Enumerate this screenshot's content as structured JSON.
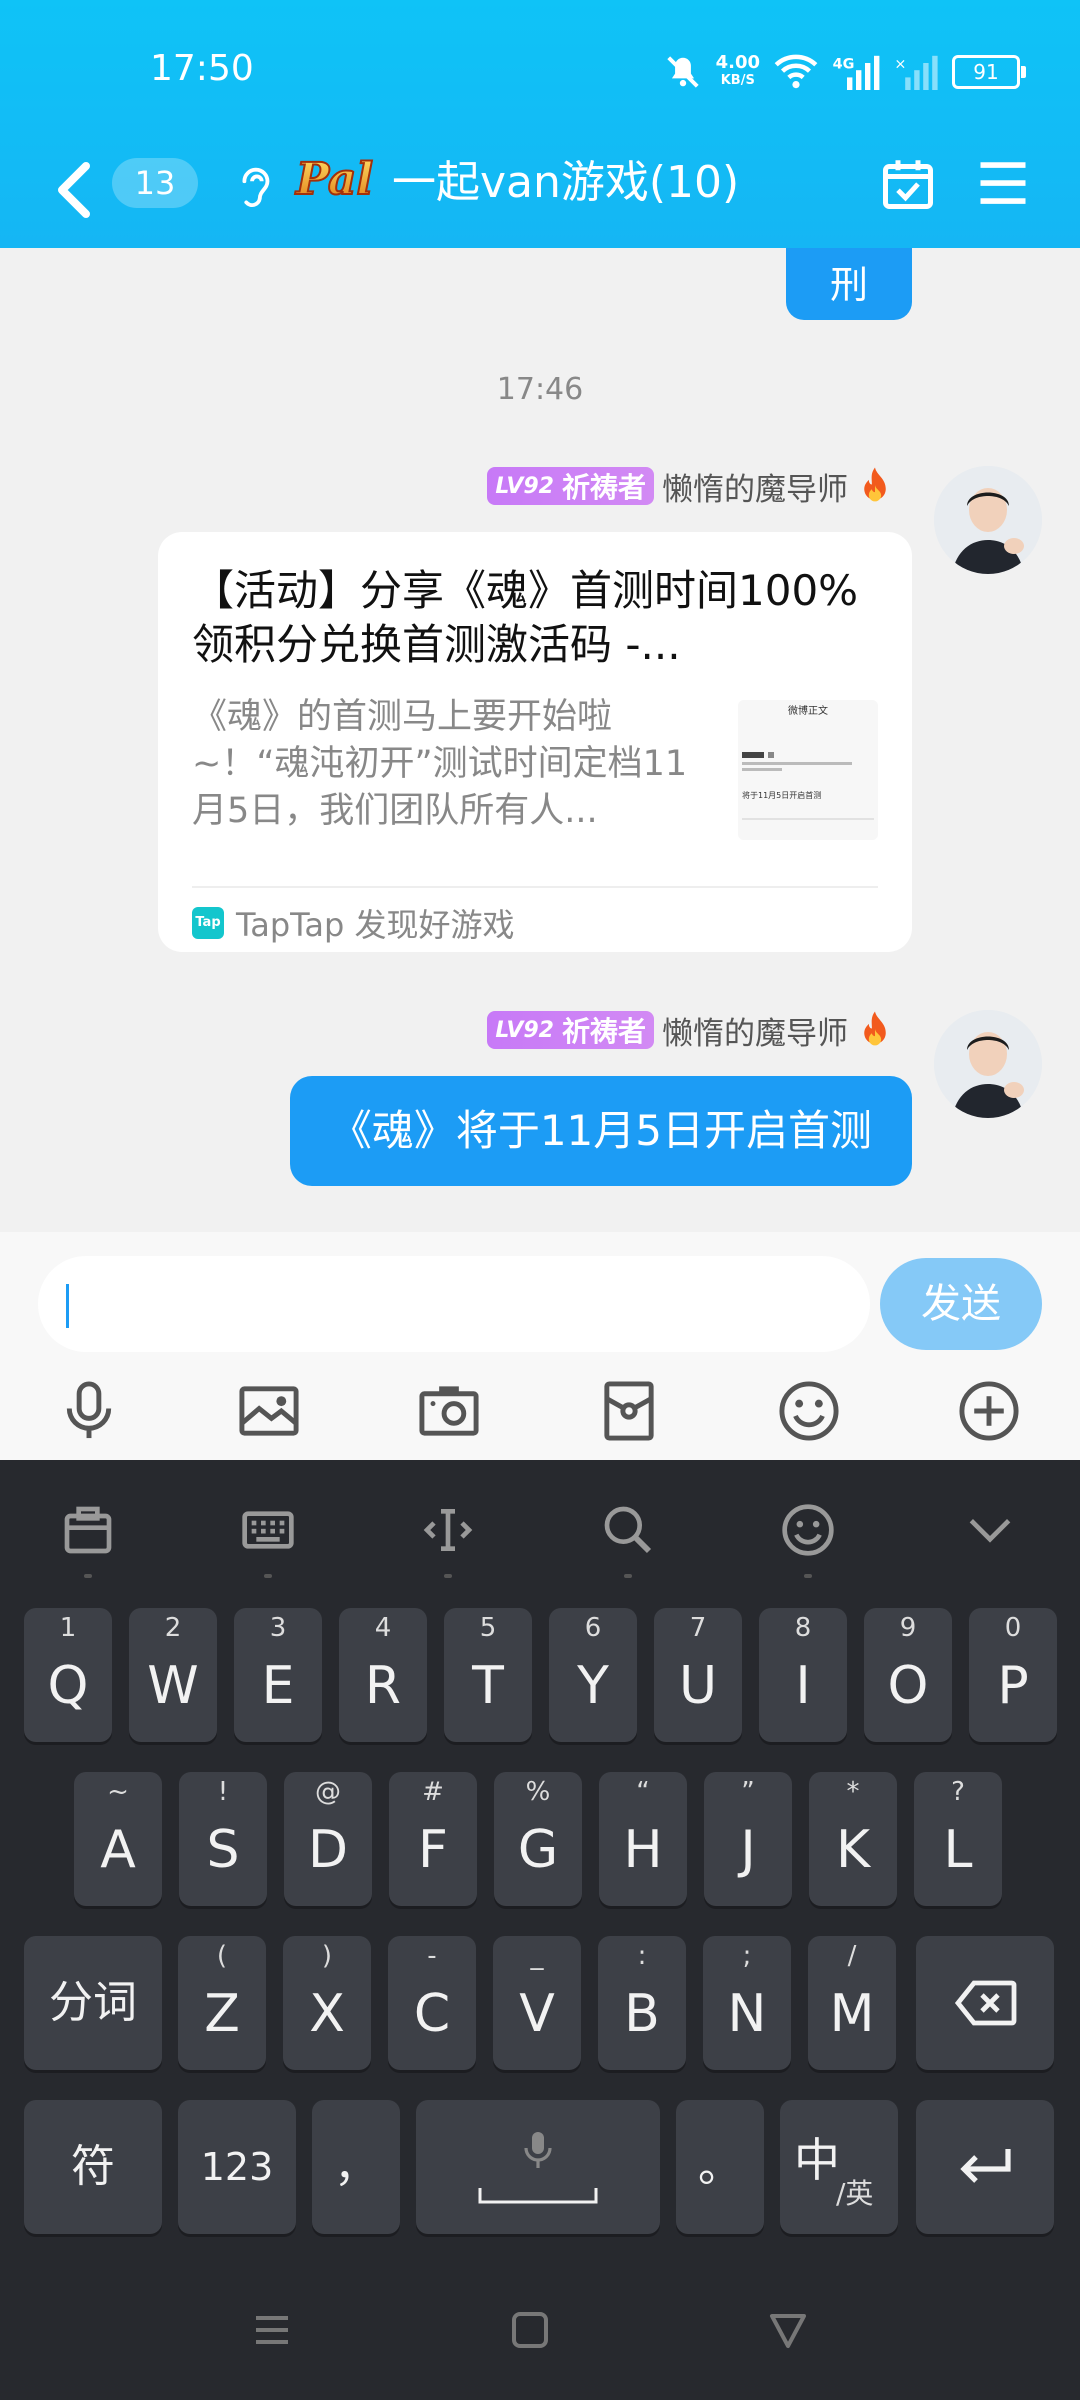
{
  "status": {
    "time": "17:50",
    "net_speed_value": "4.00",
    "net_speed_unit": "KB/S",
    "network": "4G",
    "battery": "91"
  },
  "nav": {
    "unread_count": "13",
    "group_title": "一起van游戏(10)",
    "logo_text": "Pal"
  },
  "chat": {
    "prev_message_fragment": "刑",
    "timestamp": "17:46",
    "messages": [
      {
        "sender_level": "LV92",
        "sender_title": "祈祷者",
        "sender_name": "懒惰的魔导师",
        "card_title": "【活动】分享《魂》首测时间100%领积分兑换首测激活码 -...",
        "card_description": "《魂》的首测马上要开始啦~！“魂沌初开”测试时间定档11月5日，我们团队所有人...",
        "card_source_icon": "Tap",
        "card_source": "TapTap 发现好游戏",
        "thumb_heading": "微博正文",
        "thumb_line": "将于11月5日开启首测"
      },
      {
        "sender_level": "LV92",
        "sender_title": "祈祷者",
        "sender_name": "懒惰的魔导师",
        "text": "《魂》将于11月5日开启首测"
      }
    ]
  },
  "input": {
    "value": "",
    "send_label": "发送"
  },
  "toolbar": [
    "microphone-icon",
    "image-icon",
    "camera-icon",
    "red-packet-icon",
    "emoji-icon",
    "plus-icon"
  ],
  "keyboard": {
    "row1": [
      {
        "k": "Q",
        "s": "1"
      },
      {
        "k": "W",
        "s": "2"
      },
      {
        "k": "E",
        "s": "3"
      },
      {
        "k": "R",
        "s": "4"
      },
      {
        "k": "T",
        "s": "5"
      },
      {
        "k": "Y",
        "s": "6"
      },
      {
        "k": "U",
        "s": "7"
      },
      {
        "k": "I",
        "s": "8"
      },
      {
        "k": "O",
        "s": "9"
      },
      {
        "k": "P",
        "s": "0"
      }
    ],
    "row2": [
      {
        "k": "A",
        "s": "~"
      },
      {
        "k": "S",
        "s": "!"
      },
      {
        "k": "D",
        "s": "@"
      },
      {
        "k": "F",
        "s": "#"
      },
      {
        "k": "G",
        "s": "%"
      },
      {
        "k": "H",
        "s": "“"
      },
      {
        "k": "J",
        "s": "”"
      },
      {
        "k": "K",
        "s": "*"
      },
      {
        "k": "L",
        "s": "?"
      }
    ],
    "row3": [
      {
        "k": "Z",
        "s": "("
      },
      {
        "k": "X",
        "s": ")"
      },
      {
        "k": "C",
        "s": "-"
      },
      {
        "k": "V",
        "s": "_"
      },
      {
        "k": "B",
        "s": ":"
      },
      {
        "k": "N",
        "s": ";"
      },
      {
        "k": "M",
        "s": "/"
      }
    ],
    "segment_label": "分词",
    "symbol_label": "符",
    "number_label": "123",
    "comma_label": "，",
    "period_label": "。",
    "lang_main": "中",
    "lang_sub": "/英"
  }
}
